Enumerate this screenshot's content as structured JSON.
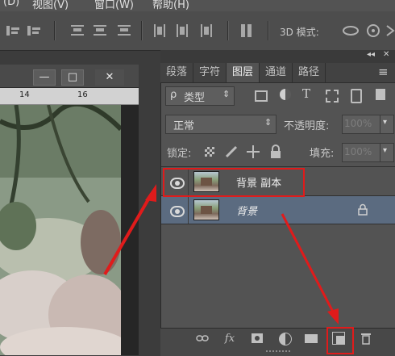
{
  "menu": [
    "(D)",
    "视图(V)",
    "窗口(W)",
    "帮助(H)"
  ],
  "options_bar": {
    "mode_3d_label": "3D 模式:"
  },
  "document": {
    "ruler_ticks": [
      "14",
      "16"
    ],
    "buttons": [
      "—",
      "□",
      "✕"
    ]
  },
  "panel": {
    "collapse_glyph": "◂◂",
    "close_glyph": "✕",
    "tabs": [
      "段落",
      "字符",
      "图层",
      "通道",
      "路径"
    ],
    "active_tab": "图层",
    "menu_glyph": "≡",
    "filter": {
      "search_glyph": "ρ",
      "label": "类型",
      "arrow": "⇕"
    },
    "blend_mode": {
      "value": "正常",
      "arrow": "⇕"
    },
    "opacity": {
      "label": "不透明度:",
      "value": "100%",
      "arrow": "▾"
    },
    "lock": {
      "label": "锁定:"
    },
    "fill": {
      "label": "填充:",
      "value": "100%",
      "arrow": "▾"
    },
    "layers": [
      {
        "name": "背景 副本",
        "visible": true,
        "selected": false
      },
      {
        "name": "背景",
        "visible": true,
        "selected": true,
        "locked": true
      }
    ],
    "footer_icons": [
      "link-icon",
      "fx-icon",
      "mask-icon",
      "adjustment-icon",
      "folder-icon",
      "new-layer-icon",
      "trash-icon"
    ],
    "fx_label": "fx"
  },
  "colors": {
    "annotation": "#e01b1b",
    "selected_layer": "#5b6b80"
  }
}
